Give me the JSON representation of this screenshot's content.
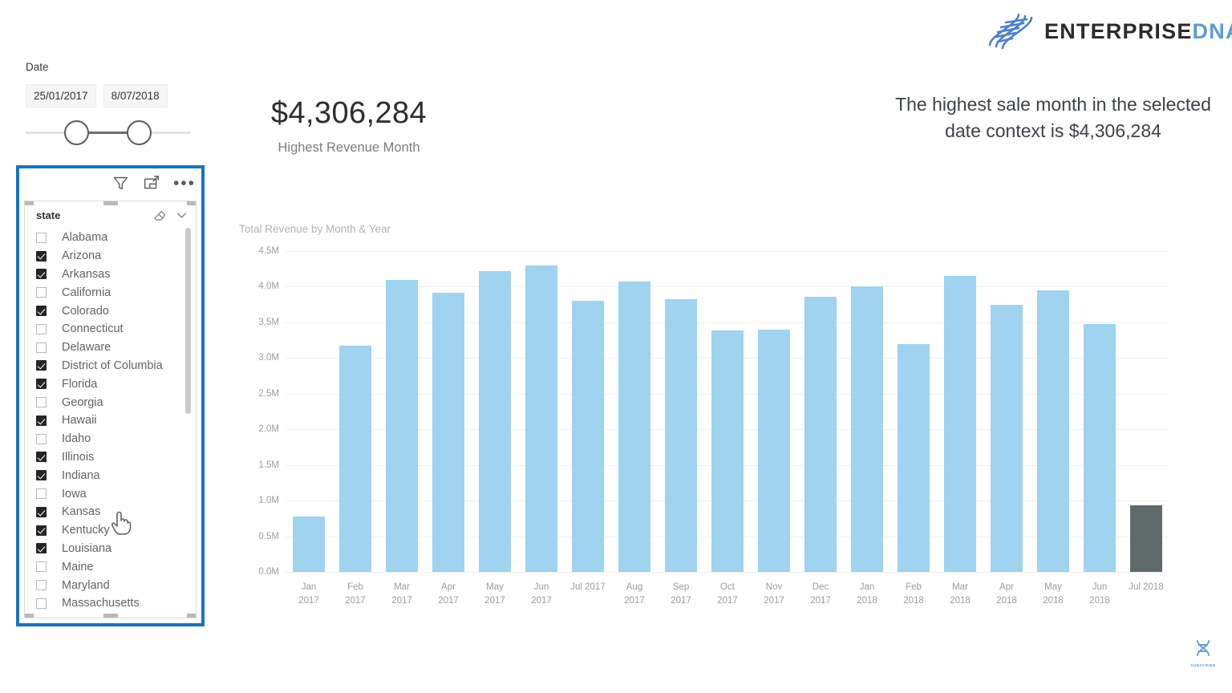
{
  "brand": {
    "name_primary": "ENTERPRISE",
    "name_secondary": "DNA",
    "icon": "dna-helix-icon",
    "accent_color": "#5b9bd5",
    "dark_color": "#2b2b2b"
  },
  "date_slicer": {
    "label": "Date",
    "start_value": "25/01/2017",
    "end_value": "8/07/2018"
  },
  "state_slicer": {
    "field_label": "state",
    "toolbar": {
      "filter_icon": "filter-funnel-icon",
      "focus_icon": "focus-mode-icon",
      "more_icon": "more-options-icon",
      "clear_icon": "eraser-clear-selections-icon",
      "expand_icon": "chevron-down-icon"
    },
    "items": [
      {
        "label": "Alabama",
        "checked": false
      },
      {
        "label": "Arizona",
        "checked": true
      },
      {
        "label": "Arkansas",
        "checked": true
      },
      {
        "label": "California",
        "checked": false
      },
      {
        "label": "Colorado",
        "checked": true
      },
      {
        "label": "Connecticut",
        "checked": false
      },
      {
        "label": "Delaware",
        "checked": false
      },
      {
        "label": "District of Columbia",
        "checked": true
      },
      {
        "label": "Florida",
        "checked": true
      },
      {
        "label": "Georgia",
        "checked": false
      },
      {
        "label": "Hawaii",
        "checked": true
      },
      {
        "label": "Idaho",
        "checked": false
      },
      {
        "label": "Illinois",
        "checked": true
      },
      {
        "label": "Indiana",
        "checked": true
      },
      {
        "label": "Iowa",
        "checked": false
      },
      {
        "label": "Kansas",
        "checked": true
      },
      {
        "label": "Kentucky",
        "checked": true
      },
      {
        "label": "Louisiana",
        "checked": true
      },
      {
        "label": "Maine",
        "checked": false
      },
      {
        "label": "Maryland",
        "checked": false
      },
      {
        "label": "Massachusetts",
        "checked": false
      }
    ]
  },
  "kpi_card": {
    "value": "$4,306,284",
    "label": "Highest Revenue Month"
  },
  "narrative_card": {
    "text": "The highest sale month in the selected date context is $4,306,284"
  },
  "subscribe": {
    "label": "SUBSCRIBE",
    "icon": "dna-helix-icon"
  },
  "chart_data": {
    "type": "bar",
    "title": "Total Revenue by Month & Year",
    "xlabel": "",
    "ylabel": "",
    "ylim": [
      0,
      4500000
    ],
    "grid": true,
    "legend": false,
    "bar_color": "#9fd3f0",
    "highlight_color": "#5e6a6a",
    "ytick_labels": [
      "4.5M",
      "4.0M",
      "3.5M",
      "3.0M",
      "2.5M",
      "2.0M",
      "1.5M",
      "1.0M",
      "0.5M",
      "0.0M"
    ],
    "ytick_values": [
      4500000,
      4000000,
      3500000,
      3000000,
      2500000,
      2000000,
      1500000,
      1000000,
      500000,
      0
    ],
    "categories": [
      "Jan 2017",
      "Feb 2017",
      "Mar 2017",
      "Apr 2017",
      "May 2017",
      "Jun 2017",
      "Jul 2017",
      "Aug 2017",
      "Sep 2017",
      "Oct 2017",
      "Nov 2017",
      "Dec 2017",
      "Jan 2018",
      "Feb 2018",
      "Mar 2018",
      "Apr 2018",
      "May 2018",
      "Jun 2018",
      "Jul 2018"
    ],
    "category_lines": [
      [
        "Jan",
        "2017"
      ],
      [
        "Feb",
        "2017"
      ],
      [
        "Mar",
        "2017"
      ],
      [
        "Apr",
        "2017"
      ],
      [
        "May",
        "2017"
      ],
      [
        "Jun",
        "2017"
      ],
      [
        "Jul 2017",
        ""
      ],
      [
        "Aug",
        "2017"
      ],
      [
        "Sep",
        "2017"
      ],
      [
        "Oct",
        "2017"
      ],
      [
        "Nov",
        "2017"
      ],
      [
        "Dec",
        "2017"
      ],
      [
        "Jan",
        "2018"
      ],
      [
        "Feb",
        "2018"
      ],
      [
        "Mar",
        "2018"
      ],
      [
        "Apr",
        "2018"
      ],
      [
        "May",
        "2018"
      ],
      [
        "Jun",
        "2018"
      ],
      [
        "Jul 2018",
        ""
      ]
    ],
    "values": [
      780000,
      3170000,
      4100000,
      3910000,
      4220000,
      4300000,
      3800000,
      4070000,
      3830000,
      3390000,
      3400000,
      3860000,
      4000000,
      3200000,
      4150000,
      3750000,
      3950000,
      3480000,
      930000
    ],
    "highlight_index": 18
  }
}
